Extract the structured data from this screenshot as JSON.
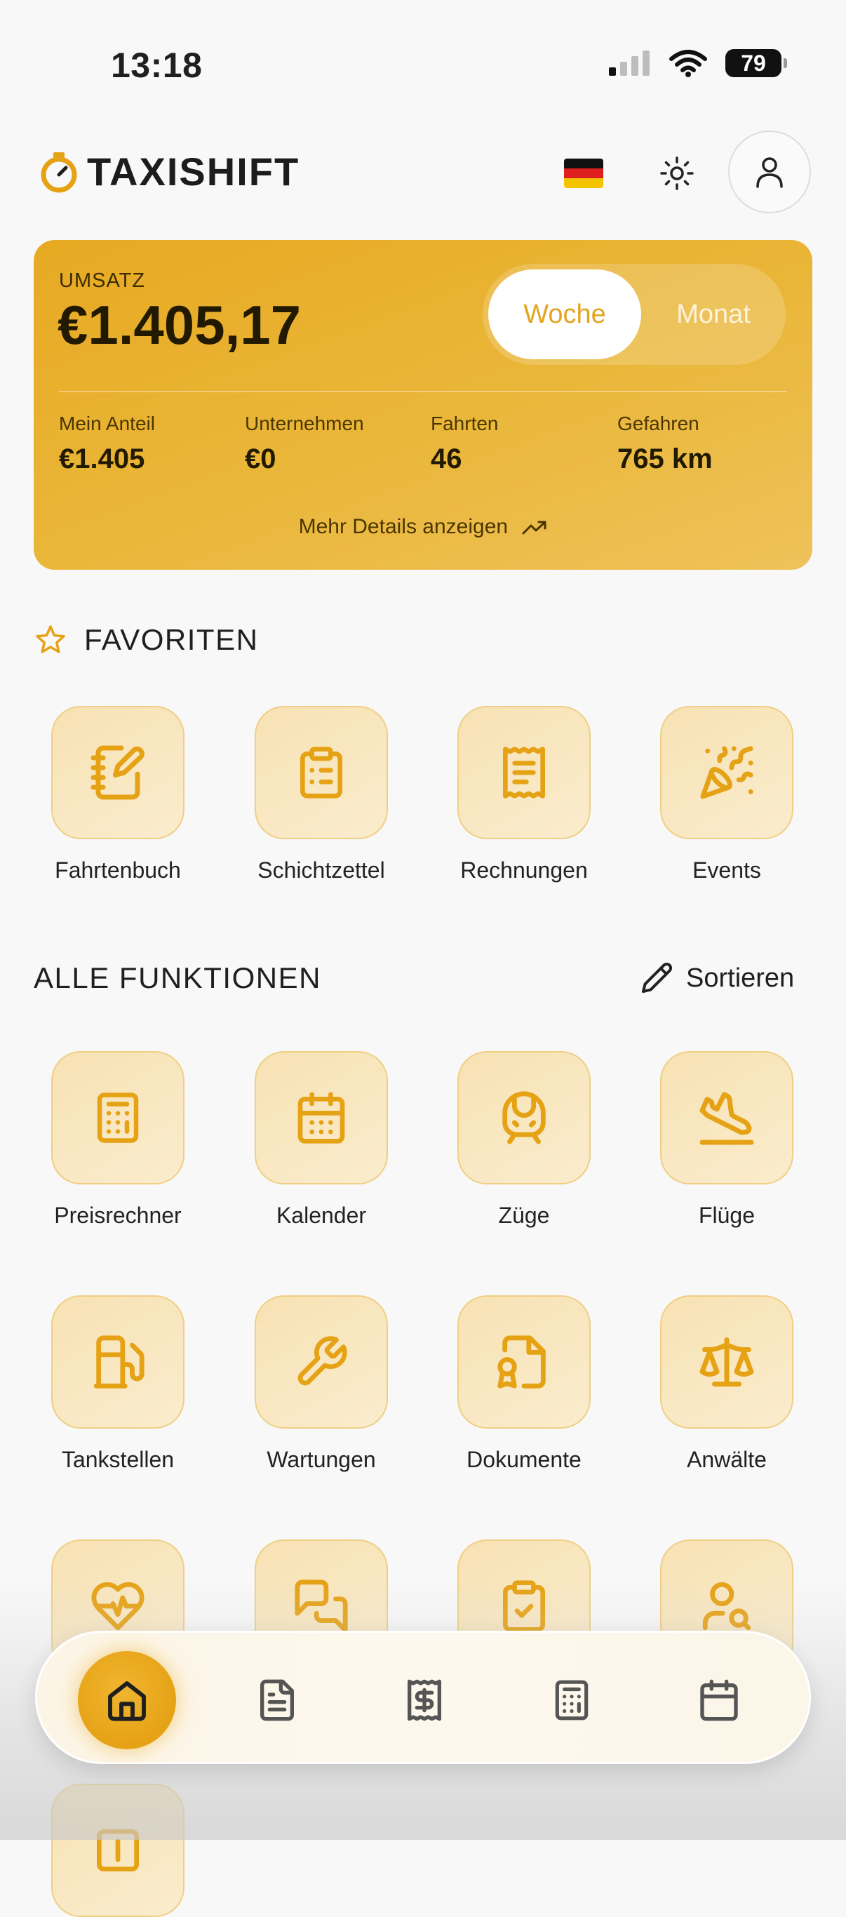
{
  "status_bar": {
    "time": "13:18",
    "battery": "79"
  },
  "header": {
    "logo_text": "TAXISHIFT"
  },
  "revenue": {
    "label": "UMSATZ",
    "value": "€1.405,17",
    "toggle": {
      "active": "Woche",
      "inactive": "Monat"
    },
    "stats": [
      {
        "label": "Mein Anteil",
        "value": "€1.405"
      },
      {
        "label": "Unternehmen",
        "value": "€0"
      },
      {
        "label": "Fahrten",
        "value": "46"
      },
      {
        "label": "Gefahren",
        "value": "765 km"
      }
    ],
    "more_details": "Mehr Details anzeigen"
  },
  "favorites": {
    "title": "FAVORITEN",
    "items": [
      {
        "label": "Fahrtenbuch",
        "icon": "notebook-pen-icon"
      },
      {
        "label": "Schichtzettel",
        "icon": "clipboard-list-icon"
      },
      {
        "label": "Rechnungen",
        "icon": "receipt-icon"
      },
      {
        "label": "Events",
        "icon": "party-popper-icon"
      }
    ]
  },
  "all_functions": {
    "title": "ALLE FUNKTIONEN",
    "sort_label": "Sortieren",
    "items": [
      {
        "label": "Preisrechner",
        "icon": "calculator-icon"
      },
      {
        "label": "Kalender",
        "icon": "calendar-icon"
      },
      {
        "label": "Züge",
        "icon": "train-icon"
      },
      {
        "label": "Flüge",
        "icon": "plane-landing-icon"
      },
      {
        "label": "Tankstellen",
        "icon": "fuel-icon"
      },
      {
        "label": "Wartungen",
        "icon": "wrench-icon"
      },
      {
        "label": "Dokumente",
        "icon": "file-badge-icon"
      },
      {
        "label": "Anwälte",
        "icon": "scale-icon"
      }
    ]
  },
  "colors": {
    "accent": "#E6A215",
    "tile_bg": "#F8E6BE",
    "tile_border": "#F0CF84"
  },
  "bottom_nav": {
    "items": [
      "home-icon",
      "document-icon",
      "receipt-dollar-icon",
      "calculator-icon",
      "calendar-icon"
    ]
  }
}
